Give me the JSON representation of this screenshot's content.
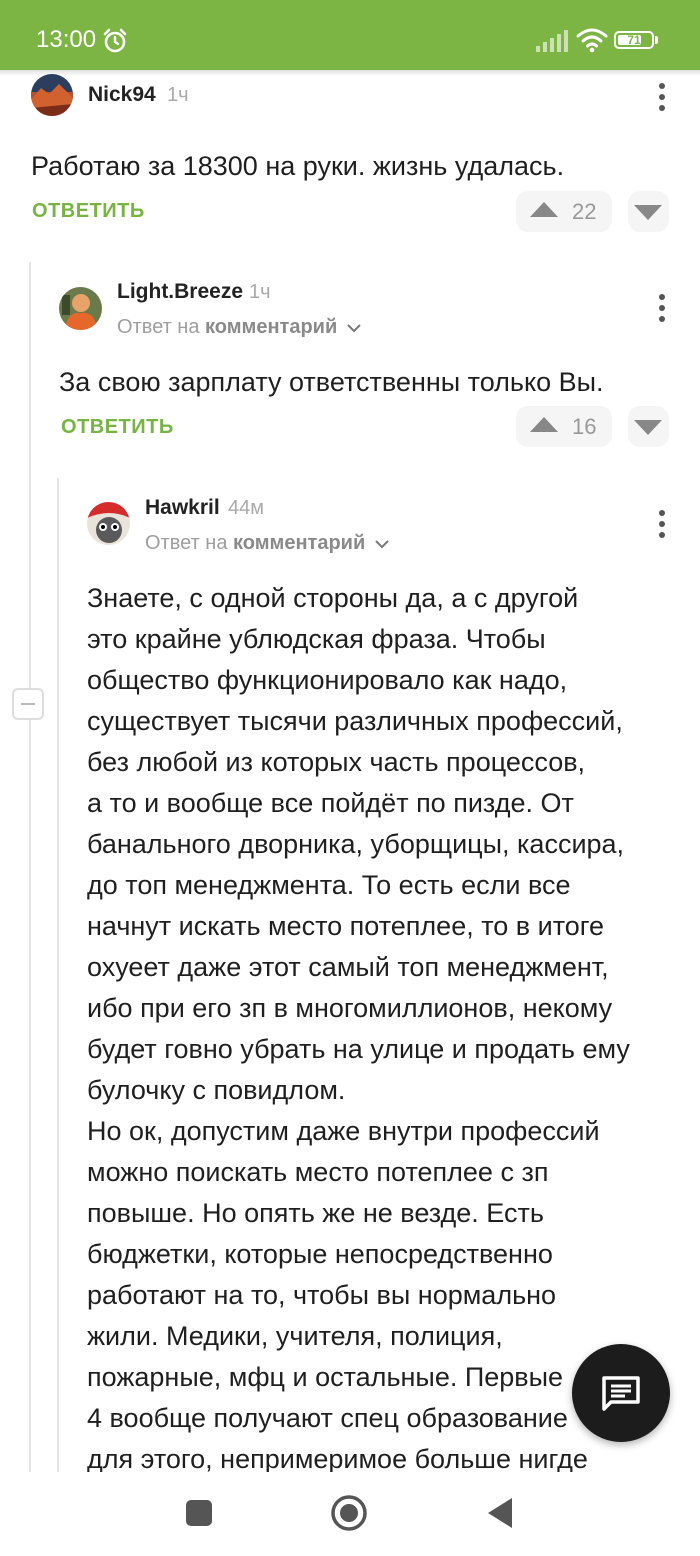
{
  "status_bar": {
    "time": "13:00",
    "battery": "71",
    "battery_level": 0.71
  },
  "comments": [
    {
      "username": "Nick94",
      "time": "1ч",
      "text": "Работаю за 18300 на руки. жизнь удалась.",
      "reply_label": "ОТВЕТИТЬ",
      "votes": "22"
    },
    {
      "username": "Light.Breeze",
      "time": "1ч",
      "reply_to_prefix": "Ответ на",
      "reply_to_target": "комментарий",
      "text": "За свою зарплату ответственны только Вы.",
      "reply_label": "ОТВЕТИТЬ",
      "votes": "16"
    },
    {
      "username": "Hawkril",
      "time": "44м",
      "reply_to_prefix": "Ответ на",
      "reply_to_target": "комментарий",
      "lines": [
        "Знаете, с одной стороны да, а с другой",
        "это крайне ублюдская фраза. Чтобы",
        "общество функционировало как надо,",
        "существует тысячи различных профессий,",
        "без любой из которых часть процессов,",
        "а то и вообще все пойдёт по пизде. От",
        "банального дворника, уборщицы, кассира,",
        "до топ менеджмента. То есть если все",
        "начнут искать место потеплее, то в итоге",
        "охуеет даже этот самый топ менеджмент,",
        "ибо при его зп в многомиллионов, некому",
        "будет говно убрать на улице и продать ему",
        "булочку с повидлом.",
        "Но ок, допустим даже внутри профессий",
        "можно поискать место потеплее с зп",
        "повыше. Но опять же не везде. Есть",
        "бюджетки, которые непосредственно",
        "работают на то, чтобы вы нормально",
        "жили. Медики, учителя, полиция,",
        "пожарные, мфц и остальные. Первые",
        "4 вообще получают спец образование",
        "для этого, непримеримое больше нигде"
      ]
    }
  ],
  "colors": {
    "accent": "#7db544",
    "reply_link": "#78b443",
    "text": "#1f1f1f",
    "muted": "#aaaaaa"
  },
  "icons": [
    "alarm-icon",
    "signal-icon",
    "wifi-icon",
    "battery-icon",
    "more-vert-icon",
    "upvote-icon",
    "downvote-icon",
    "chevron-down-icon",
    "collapse-icon",
    "comment-fab-icon",
    "nav-recents-icon",
    "nav-home-icon",
    "nav-back-icon"
  ]
}
